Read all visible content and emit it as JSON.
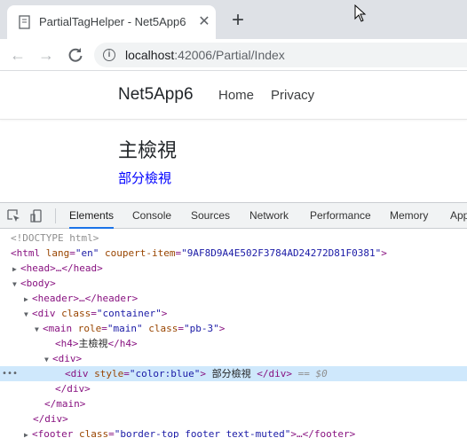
{
  "browser": {
    "tab_title": "PartialTagHelper - Net5App6",
    "url_host": "localhost",
    "url_rest": ":42006/Partial/Index"
  },
  "page": {
    "brand": "Net5App6",
    "nav": [
      "Home",
      "Privacy"
    ],
    "heading": "主檢視",
    "partial_text": "部分檢視",
    "partial_color": "#0000ff"
  },
  "devtools": {
    "tabs": [
      "Elements",
      "Console",
      "Sources",
      "Network",
      "Performance",
      "Memory",
      "App"
    ],
    "active_tab": "Elements",
    "dom": {
      "doctype": "<!DOCTYPE html>",
      "html_lang": "\"en\"",
      "html_attr_name": "coupert-item",
      "html_attr_val": "\"9AF8D9A4E502F3784AD24272D81F0381\"",
      "head": "<head>…</head>",
      "body_open": "<body>",
      "header": "<header>…</header>",
      "div_container_class": "\"container\"",
      "main_role": "\"main\"",
      "main_class": "\"pb-3\"",
      "h4_text": "主檢視",
      "div_open": "<div>",
      "style_val": "\"color:blue\"",
      "partial_text": " 部分檢視 ",
      "selected_marker": "== $0",
      "div_close": "</div>",
      "main_close": "</main>",
      "footer_class": "\"border-top footer text-muted\"",
      "footer_end": ">…</footer>"
    }
  }
}
